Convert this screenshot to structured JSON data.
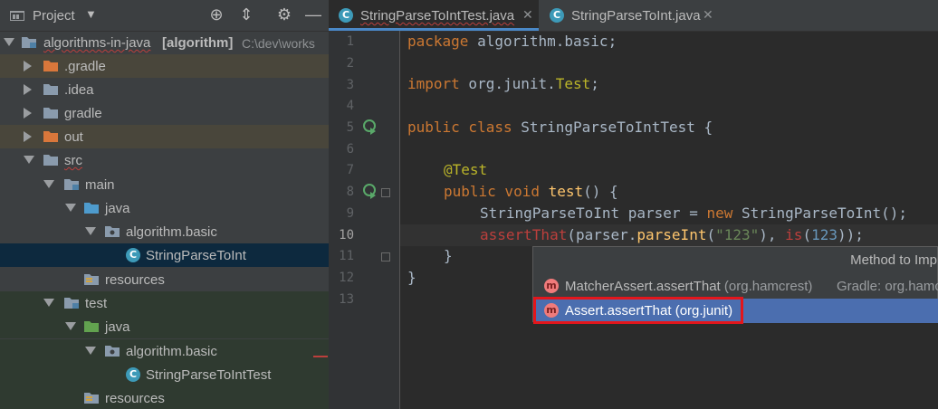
{
  "project_panel": {
    "title": "Project",
    "tree": [
      {
        "label": "algorithms-in-java",
        "module": "[algorithm]",
        "path": "C:\\dev\\works"
      },
      {
        "label": ".gradle"
      },
      {
        "label": ".idea"
      },
      {
        "label": "gradle"
      },
      {
        "label": "out"
      },
      {
        "label": "src"
      },
      {
        "label": "main"
      },
      {
        "label": "java"
      },
      {
        "label": "algorithm.basic"
      },
      {
        "label": "StringParseToInt"
      },
      {
        "label": "resources"
      },
      {
        "label": "test"
      },
      {
        "label": "java"
      },
      {
        "label": "algorithm.basic"
      },
      {
        "label": "StringParseToIntTest"
      },
      {
        "label": "resources"
      }
    ]
  },
  "tabs": [
    {
      "label": "StringParseToIntTest.java",
      "icon": "C",
      "active": true
    },
    {
      "label": "StringParseToInt.java",
      "icon": "C",
      "active": false
    }
  ],
  "editor": {
    "line_numbers": [
      "1",
      "2",
      "3",
      "4",
      "5",
      "6",
      "7",
      "8",
      "9",
      "10",
      "11",
      "12",
      "13"
    ],
    "current_line": "10",
    "lines": {
      "l1_kw": "package",
      "l1_rest": " algorithm.basic;",
      "l3_kw": "import",
      "l3_pkg": " org.junit.",
      "l3_cls": "Test",
      "l3_end": ";",
      "l5_kw1": "public",
      "l5_kw2": " class",
      "l5_name": " StringParseToIntTest {",
      "l7_ann": "@Test",
      "l8_kw1": "public",
      "l8_kw2": " void",
      "l8_fn": " test",
      "l8_end": "() {",
      "l9_type": "StringParseToInt parser = ",
      "l9_kw": "new",
      "l9_ctor": " StringParseToInt();",
      "l10_err1": "assertThat",
      "l10_a": "(parser.",
      "l10_fn": "parseInt",
      "l10_b": "(",
      "l10_str": "\"123\"",
      "l10_c": "), ",
      "l10_err2": "is",
      "l10_d": "(",
      "l10_num": "123",
      "l10_e": "));",
      "l11": "}",
      "l12": "}"
    }
  },
  "popup": {
    "title": "Method to Imp",
    "items": [
      {
        "icon": "m",
        "label": "MatcherAssert.assertThat",
        "pkg": "(org.hamcrest)",
        "hint": "Gradle: org.hamc"
      },
      {
        "icon": "m",
        "label": "Assert.assertThat",
        "pkg": "(org.junit)",
        "hint": ""
      }
    ]
  },
  "colors": {
    "keyword": "#cc7832",
    "annotation": "#bbb529",
    "function": "#ffc66d",
    "error": "#bc3f3c",
    "string": "#6a8759",
    "number": "#6897bb",
    "selection": "#4b6eaf",
    "highlight_box": "#e3161c"
  }
}
